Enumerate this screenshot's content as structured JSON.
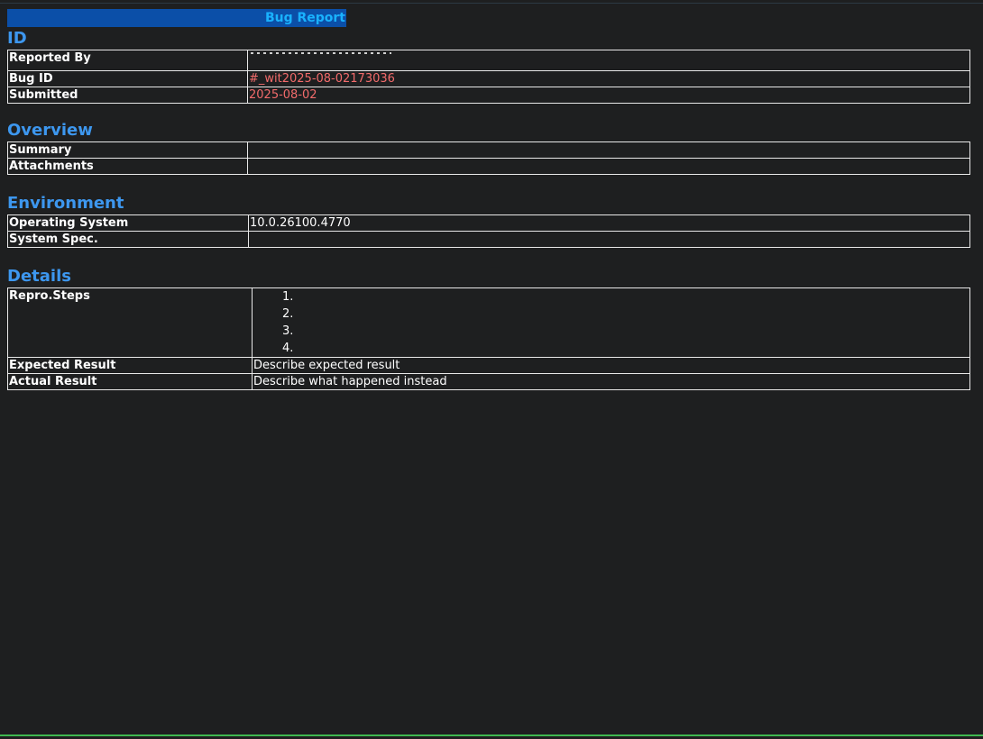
{
  "report": {
    "banner_title": "Bug Report"
  },
  "sections": {
    "id": {
      "title": "ID",
      "rows": [
        {
          "label": "Reported By",
          "value": ""
        },
        {
          "label": "Bug ID",
          "value": "#_wit2025-08-02173036"
        },
        {
          "label": "Submitted",
          "value": "2025-08-02"
        }
      ]
    },
    "overview": {
      "title": "Overview",
      "rows": [
        {
          "label": "Summary",
          "value": ""
        },
        {
          "label": "Attachments",
          "value": ""
        }
      ]
    },
    "environment": {
      "title": "Environment",
      "rows": [
        {
          "label": "Operating System",
          "value": "10.0.26100.4770"
        },
        {
          "label": "System Spec.",
          "value": ""
        }
      ]
    },
    "details": {
      "title": "Details",
      "repro_label": "Repro.Steps",
      "repro_steps": [
        "1.",
        "2.",
        "3.",
        "4."
      ],
      "rows": [
        {
          "label": "Expected Result",
          "value": "Describe expected result"
        },
        {
          "label": "Actual Result",
          "value": "Describe what happened instead"
        }
      ]
    }
  },
  "colors": {
    "banner_bg": "#0b4fa8",
    "banner_text": "#19b2ff",
    "section_title": "#3d97ef",
    "highlight_value": "#f26b6b",
    "background": "#1e1f20"
  }
}
